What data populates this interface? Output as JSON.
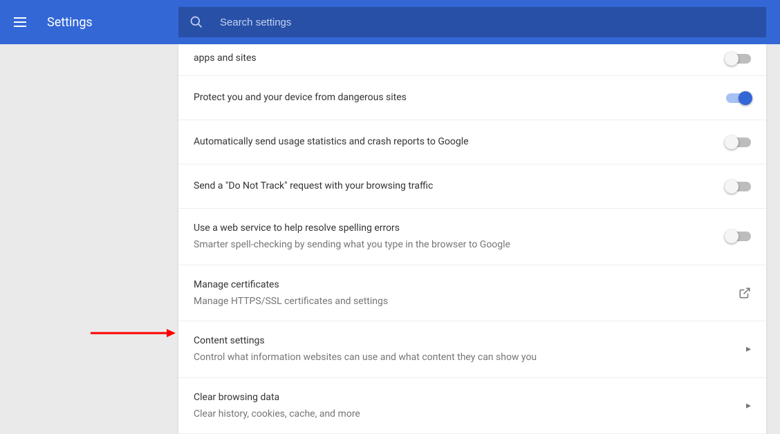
{
  "header": {
    "title": "Settings",
    "searchPlaceholder": "Search settings"
  },
  "rows": {
    "appsAndSites": {
      "title": "apps and sites",
      "toggle": false
    },
    "protectDevice": {
      "title": "Protect you and your device from dangerous sites",
      "toggle": true
    },
    "usageStats": {
      "title": "Automatically send usage statistics and crash reports to Google",
      "toggle": false
    },
    "doNotTrack": {
      "title": "Send a \"Do Not Track\" request with your browsing traffic",
      "toggle": false
    },
    "spelling": {
      "title": "Use a web service to help resolve spelling errors",
      "sub": "Smarter spell-checking by sending what you type in the browser to Google",
      "toggle": false
    },
    "certificates": {
      "title": "Manage certificates",
      "sub": "Manage HTTPS/SSL certificates and settings"
    },
    "contentSettings": {
      "title": "Content settings",
      "sub": "Control what information websites can use and what content they can show you"
    },
    "clearData": {
      "title": "Clear browsing data",
      "sub": "Clear history, cookies, cache, and more"
    }
  }
}
